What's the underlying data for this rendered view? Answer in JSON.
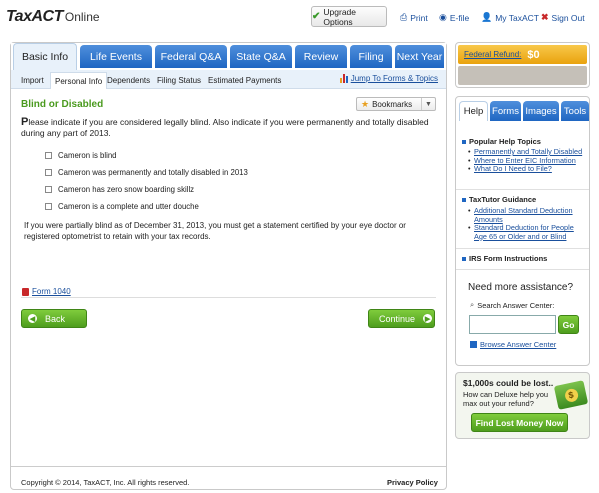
{
  "header": {
    "logo_tax": "TaxACT",
    "logo_online": "Online",
    "upgrade_label": "Upgrade Options",
    "print_label": "Print",
    "efile_label": "E-file",
    "mytaxact_label": "My TaxACT",
    "signout_label": "Sign Out"
  },
  "tabs": [
    {
      "label": "Basic Info",
      "active": true
    },
    {
      "label": "Life Events",
      "active": false
    },
    {
      "label": "Federal Q&A",
      "active": false
    },
    {
      "label": "State Q&A",
      "active": false
    },
    {
      "label": "Review",
      "active": false
    },
    {
      "label": "Filing",
      "active": false
    },
    {
      "label": "Next Year",
      "active": false
    }
  ],
  "subnav": [
    {
      "label": "Import",
      "active": false
    },
    {
      "label": "Personal Info",
      "active": true
    },
    {
      "label": "Dependents",
      "active": false
    },
    {
      "label": "Filing Status",
      "active": false
    },
    {
      "label": "Estimated Payments",
      "active": false
    }
  ],
  "jump_label": "Jump To Forms & Topics",
  "page": {
    "title": "Blind or Disabled",
    "bookmarks_label": "Bookmarks",
    "instruction_first": "P",
    "instruction_rest": "lease indicate if you are considered legally blind. Also indicate if you were permanently and totally disabled during any part of 2013.",
    "checkboxes": [
      "Cameron is blind",
      "Cameron was permanently and totally disabled in 2013",
      "Cameron has zero snow boarding skillz",
      "Cameron is a complete and utter douche"
    ],
    "note": "If you were partially blind as of December 31, 2013, you must get a statement certified by your eye doctor or registered optometrist to retain with your tax records.",
    "form_link": "Form 1040",
    "back_label": "Back",
    "continue_label": "Continue"
  },
  "footer": {
    "copyright": "Copyright © 2014, TaxACT, Inc. All rights reserved.",
    "privacy": "Privacy Policy"
  },
  "refund": {
    "label": "Federal Refund:",
    "amount": "$0"
  },
  "help": {
    "tabs": [
      "Help",
      "Forms",
      "Images",
      "Tools"
    ],
    "popular_title": "Popular Help Topics",
    "popular_links": [
      "Permanently and Totally Disabled",
      "Where to Enter EIC Information",
      "What Do I Need to File?"
    ],
    "tutor_title": "TaxTutor Guidance",
    "tutor_links": [
      "Additional Standard Deduction Amounts",
      "Standard Deduction for People Age 65 or Older and or Blind"
    ],
    "irs_title": "IRS Form Instructions",
    "need_title": "Need more assistance?",
    "search_label": "Search Answer Center:",
    "go_label": "Go",
    "browse_label": "Browse Answer Center"
  },
  "promo": {
    "title": "$1,000s could be lost..",
    "text": "How can Deluxe help you max out your refund?",
    "button": "Find Lost Money Now"
  },
  "colors": {
    "tab_blue": "#1f66c2",
    "accent_green": "#4e9d1d",
    "title_green": "#4a9a1e",
    "refund_orange": "#e9a20e",
    "link_blue": "#1a4f9c"
  }
}
